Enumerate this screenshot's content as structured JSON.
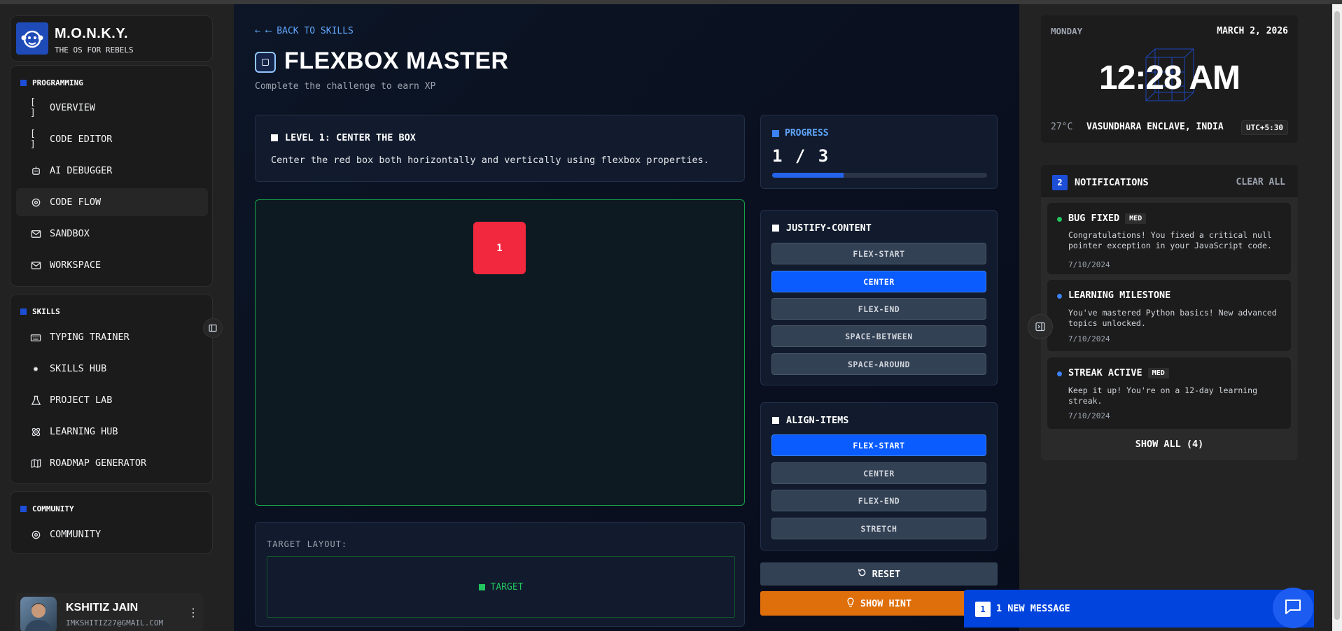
{
  "brand": {
    "title": "M.O.N.K.Y.",
    "subtitle": "THE OS FOR REBELS"
  },
  "sidebar": {
    "sections": [
      {
        "heading": "PROGRAMMING",
        "items": [
          {
            "label": "OVERVIEW",
            "icon": "brackets-icon"
          },
          {
            "label": "CODE EDITOR",
            "icon": "brackets-icon"
          },
          {
            "label": "AI DEBUGGER",
            "icon": "robot-icon"
          },
          {
            "label": "CODE FLOW",
            "icon": "gear-icon"
          },
          {
            "label": "SANDBOX",
            "icon": "mail-icon"
          },
          {
            "label": "WORKSPACE",
            "icon": "mail-icon"
          }
        ]
      },
      {
        "heading": "SKILLS",
        "items": [
          {
            "label": "TYPING TRAINER",
            "icon": "keyboard-icon"
          },
          {
            "label": "SKILLS HUB",
            "icon": "sun-icon"
          },
          {
            "label": "PROJECT LAB",
            "icon": "flask-icon"
          },
          {
            "label": "LEARNING HUB",
            "icon": "atom-icon"
          },
          {
            "label": "ROADMAP GENERATOR",
            "icon": "map-icon"
          }
        ]
      },
      {
        "heading": "COMMUNITY",
        "items": [
          {
            "label": "COMMUNITY",
            "icon": "gear-icon"
          }
        ]
      }
    ],
    "active_item": "CODE FLOW"
  },
  "user": {
    "name": "KSHITIZ JAIN",
    "email": "IMKSHITIZ27@GMAIL.COM"
  },
  "main": {
    "back_link": "← ⟵ BACK TO SKILLS",
    "title": "FLEXBOX MASTER",
    "subtitle": "Complete the challenge to earn XP",
    "level": {
      "title": "LEVEL 1: CENTER THE BOX",
      "description": "Center the red box both horizontally and vertically using flexbox properties."
    },
    "box_label": "1",
    "target": {
      "label": "TARGET LAYOUT:",
      "text": "TARGET"
    },
    "progress": {
      "label": "PROGRESS",
      "value": "1 / 3",
      "fraction": 0.333
    },
    "justify": {
      "title": "JUSTIFY-CONTENT",
      "options": [
        "FLEX-START",
        "CENTER",
        "FLEX-END",
        "SPACE-BETWEEN",
        "SPACE-AROUND"
      ],
      "selected": "CENTER"
    },
    "align": {
      "title": "ALIGN-ITEMS",
      "options": [
        "FLEX-START",
        "CENTER",
        "FLEX-END",
        "STRETCH"
      ],
      "selected": "FLEX-START"
    },
    "reset_label": "RESET",
    "hint_label": "SHOW HINT"
  },
  "clock": {
    "day": "MONDAY",
    "date": "MARCH 2, 2026",
    "time": "12:28 AM",
    "temp": "27°C",
    "location": "VASUNDHARA ENCLAVE, INDIA",
    "tz": "UTC+5:30"
  },
  "notifications": {
    "count": "2",
    "title": "NOTIFICATIONS",
    "clear_label": "CLEAR ALL",
    "items": [
      {
        "title": "BUG FIXED",
        "badge": "MED",
        "body": "Congratulations! You fixed a critical null pointer exception in your JavaScript code.",
        "date": "7/10/2024",
        "dot": "#22c55e"
      },
      {
        "title": "LEARNING MILESTONE",
        "badge": "",
        "body": "You've mastered Python basics! New advanced topics unlocked.",
        "date": "7/10/2024",
        "dot": "#3b82f6"
      },
      {
        "title": "STREAK ACTIVE",
        "badge": "MED",
        "body": "Keep it up! You're on a 12-day learning streak.",
        "date": "7/10/2024",
        "dot": "#3b82f6"
      }
    ],
    "show_all": "SHOW ALL (4)"
  },
  "messages": {
    "count": "1",
    "label": "1 NEW MESSAGE"
  },
  "colors": {
    "accent": "#0b5cff",
    "box": "#f2283e",
    "hint": "#df6f0b",
    "success": "#22c55e"
  }
}
